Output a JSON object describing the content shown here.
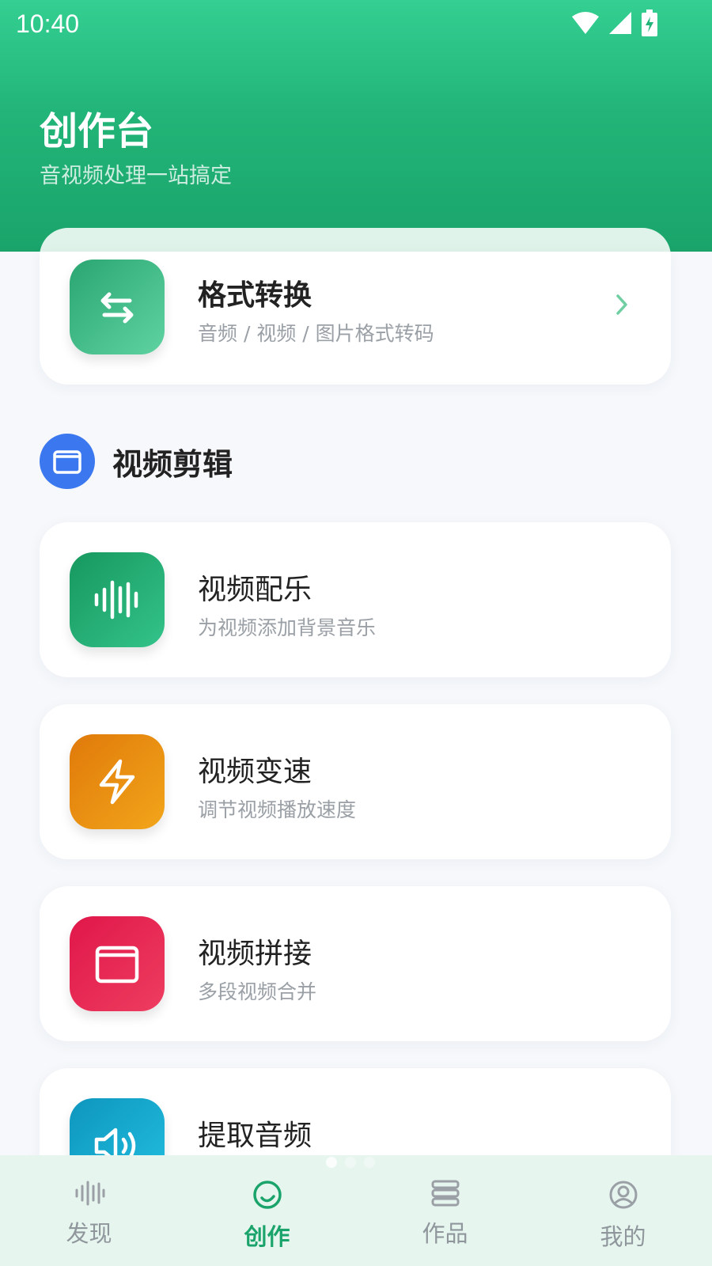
{
  "status_bar": {
    "time": "10:40"
  },
  "header": {
    "title": "创作台",
    "subtitle": "音视频处理一站搞定"
  },
  "format_card": {
    "title": "格式转换",
    "desc": "音频 / 视频 / 图片格式转码",
    "icon": "swap-arrows-icon",
    "color": "#2fb07a"
  },
  "section": {
    "title": "视频剪辑",
    "icon": "film-icon",
    "color": "#3b78f0"
  },
  "tools": [
    {
      "title": "视频配乐",
      "desc": "为视频添加背景音乐",
      "icon": "waveform-icon",
      "color": "#1fa36c"
    },
    {
      "title": "视频变速",
      "desc": "调节视频播放速度",
      "icon": "lightning-icon",
      "color": "#e98a10"
    },
    {
      "title": "视频拼接",
      "desc": "多段视频合并",
      "icon": "film-icon",
      "color": "#e62a52"
    },
    {
      "title": "提取音频",
      "desc": "",
      "icon": "speaker-icon",
      "color": "#13a7c9"
    }
  ],
  "bottom_nav": {
    "items": [
      {
        "label": "发现",
        "icon": "waveform-icon",
        "active": false
      },
      {
        "label": "创作",
        "icon": "create-circle-icon",
        "active": true
      },
      {
        "label": "作品",
        "icon": "stack-icon",
        "active": false
      },
      {
        "label": "我的",
        "icon": "user-icon",
        "active": false
      }
    ]
  }
}
